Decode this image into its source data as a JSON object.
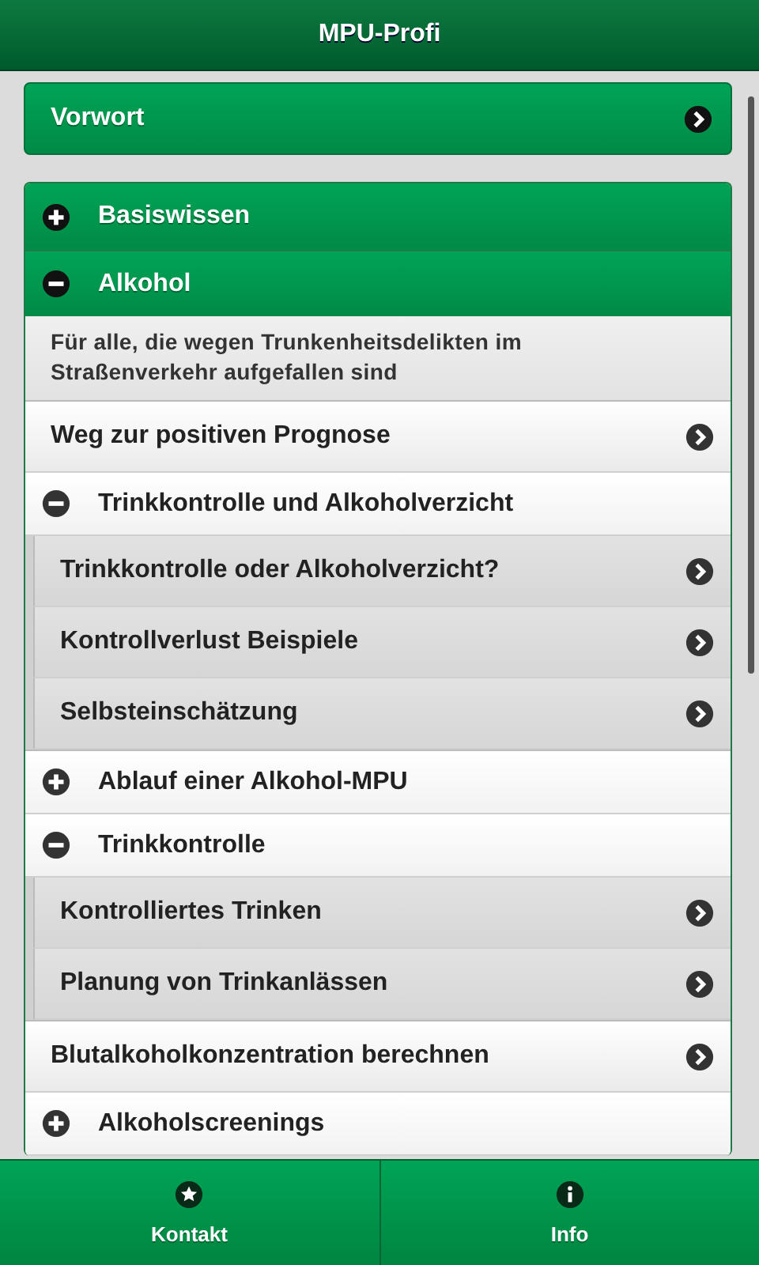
{
  "header": {
    "title": "MPU-Profi"
  },
  "intro_button": {
    "label": "Vorwort"
  },
  "sections": [
    {
      "title": "Basiswissen",
      "expanded": false
    },
    {
      "title": "Alkohol",
      "expanded": true,
      "description": "Für alle, die wegen Trunkenheitsdelikten im Straßenverkehr aufgefallen sind",
      "items": [
        {
          "kind": "link",
          "label": "Weg zur positiven Prognose"
        },
        {
          "kind": "group",
          "label": "Trinkkontrolle und Alkoholverzicht",
          "expanded": true,
          "children": [
            {
              "label": "Trinkkontrolle oder Alkoholverzicht?"
            },
            {
              "label": "Kontrollverlust Beispiele"
            },
            {
              "label": "Selbsteinschätzung"
            }
          ]
        },
        {
          "kind": "group",
          "label": "Ablauf einer Alkohol-MPU",
          "expanded": false
        },
        {
          "kind": "group",
          "label": "Trinkkontrolle",
          "expanded": true,
          "children": [
            {
              "label": "Kontrolliertes Trinken"
            },
            {
              "label": "Planung von Trinkanlässen"
            }
          ]
        },
        {
          "kind": "link",
          "label": "Blutalkoholkonzentration berechnen"
        },
        {
          "kind": "group",
          "label": "Alkoholscreenings",
          "expanded": false
        }
      ]
    }
  ],
  "footer_tabs": [
    {
      "label": "Kontakt"
    },
    {
      "label": "Info"
    }
  ]
}
